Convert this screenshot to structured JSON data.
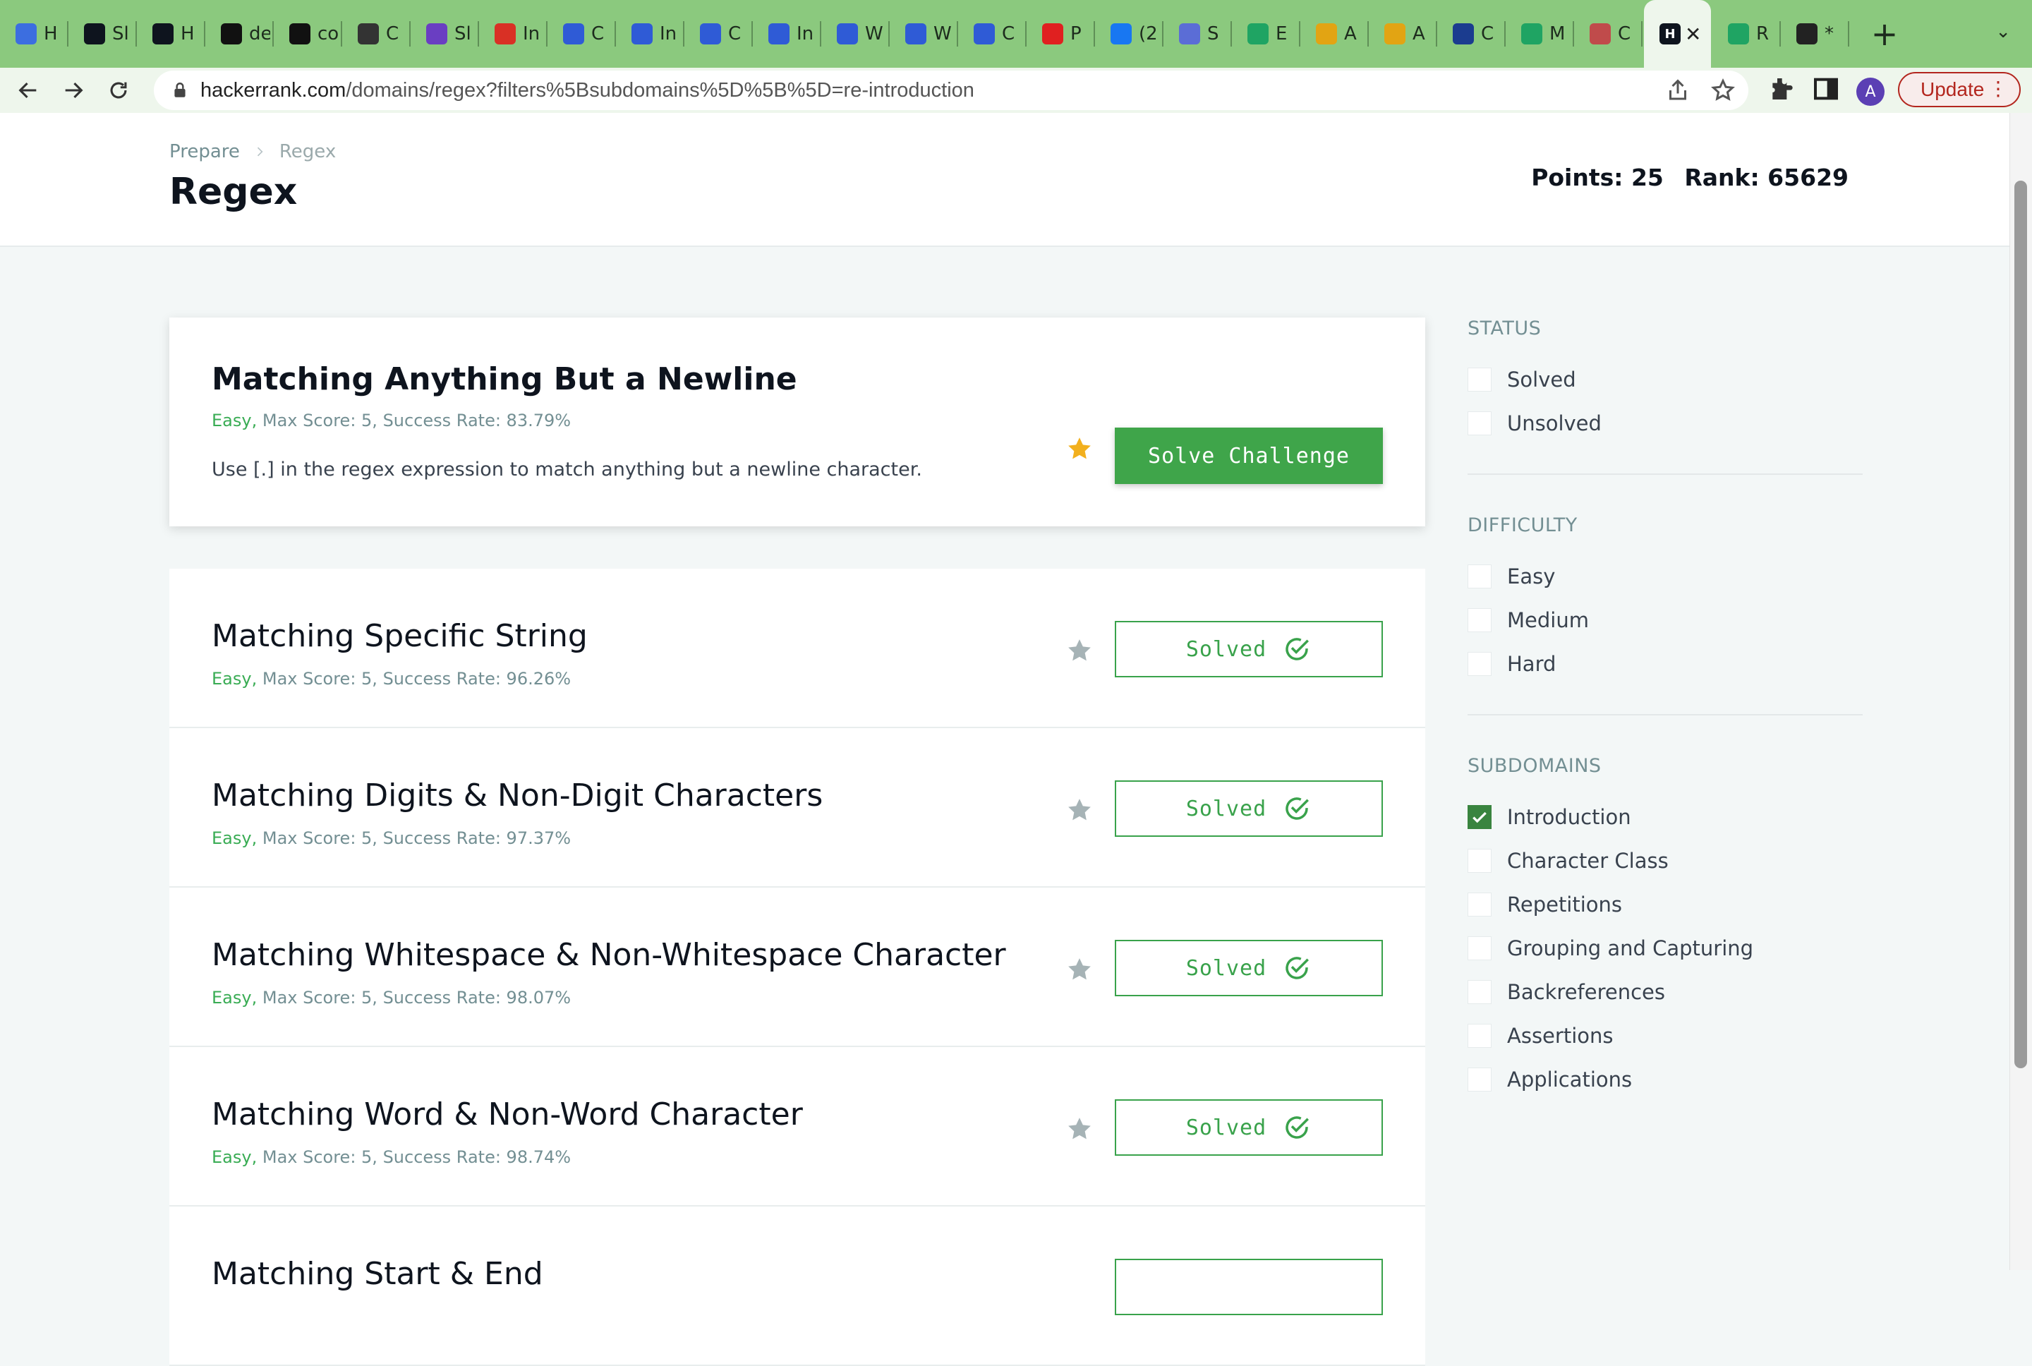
{
  "browser": {
    "tabs": [
      {
        "title": "H",
        "icon": "person-icon",
        "color": "#3c6ee0"
      },
      {
        "title": "Sl",
        "icon": "hackerrank-icon",
        "color": "#0e141e"
      },
      {
        "title": "H",
        "icon": "hackerrank-icon",
        "color": "#0e141e"
      },
      {
        "title": "de",
        "icon": "github-icon",
        "color": "#111111"
      },
      {
        "title": "co",
        "icon": "github-icon",
        "color": "#111111"
      },
      {
        "title": "C",
        "icon": "brain-icon",
        "color": "#333333"
      },
      {
        "title": "Sl",
        "icon": "list-icon",
        "color": "#6a3ec2"
      },
      {
        "title": "In",
        "icon": "gmail-icon",
        "color": "#d93025"
      },
      {
        "title": "C",
        "icon": "c-icon",
        "color": "#2f5bd6"
      },
      {
        "title": "In",
        "icon": "c-icon",
        "color": "#2f5bd6"
      },
      {
        "title": "C",
        "icon": "c-icon",
        "color": "#2f5bd6"
      },
      {
        "title": "In",
        "icon": "c-icon",
        "color": "#2f5bd6"
      },
      {
        "title": "W",
        "icon": "c-icon",
        "color": "#2f5bd6"
      },
      {
        "title": "W",
        "icon": "c-icon",
        "color": "#2f5bd6"
      },
      {
        "title": "C",
        "icon": "c-icon",
        "color": "#2f5bd6"
      },
      {
        "title": "P",
        "icon": "youtube-icon",
        "color": "#e02020"
      },
      {
        "title": "(2",
        "icon": "facebook-icon",
        "color": "#1877f2"
      },
      {
        "title": "S",
        "icon": "wave-icon",
        "color": "#5b6dd6"
      },
      {
        "title": "E",
        "icon": "drive-icon",
        "color": "#1fa463"
      },
      {
        "title": "A",
        "icon": "link-icon",
        "color": "#e2a413"
      },
      {
        "title": "A",
        "icon": "link-icon",
        "color": "#e2a413"
      },
      {
        "title": "C",
        "icon": "circle-icon",
        "color": "#1b3c8f"
      },
      {
        "title": "M",
        "icon": "drive-icon",
        "color": "#1fa463"
      },
      {
        "title": "C",
        "icon": "doc-icon",
        "color": "#c04b4b"
      }
    ],
    "active_tab": {
      "icon": "hackerrank-icon",
      "close": "✕"
    },
    "after_tabs": [
      {
        "title": "R",
        "icon": "drive-icon",
        "color": "#1fa463"
      },
      {
        "title": "*",
        "icon": "globe-icon",
        "color": "#222222"
      }
    ],
    "new_tab": "+",
    "tab_menu": "⌄",
    "url_host": "hackerrank.com",
    "url_path": "/domains/regex?filters%5Bsubdomains%5D%5B%5D=re-introduction",
    "profile_initial": "A",
    "update_label": "Update"
  },
  "header": {
    "breadcrumb": [
      "Prepare",
      "Regex"
    ],
    "title": "Regex",
    "points": "Points: 25",
    "rank": "Rank: 65629"
  },
  "challenges": [
    {
      "title": "Matching Anything But a Newline",
      "difficulty": "Easy,",
      "meta": "Max Score: 5, Success Rate: 83.79%",
      "description": "Use [.] in the regex expression to match anything but a newline character.",
      "action": "Solve Challenge",
      "featured": true,
      "star_color": "#f2b01e"
    },
    {
      "title": "Matching Specific String",
      "difficulty": "Easy,",
      "meta": "Max Score: 5, Success Rate: 96.26%",
      "action": "Solved",
      "star_color": "#a6b3b6"
    },
    {
      "title": "Matching Digits & Non-Digit Characters",
      "difficulty": "Easy,",
      "meta": "Max Score: 5, Success Rate: 97.37%",
      "action": "Solved",
      "star_color": "#a6b3b6"
    },
    {
      "title": "Matching Whitespace & Non-Whitespace Character",
      "difficulty": "Easy,",
      "meta": "Max Score: 5, Success Rate: 98.07%",
      "action": "Solved",
      "star_color": "#a6b3b6"
    },
    {
      "title": "Matching Word & Non-Word Character",
      "difficulty": "Easy,",
      "meta": "Max Score: 5, Success Rate: 98.74%",
      "action": "Solved",
      "star_color": "#a6b3b6"
    },
    {
      "title": "Matching Start & End",
      "difficulty": "",
      "meta": "",
      "action": "",
      "star_color": "#a6b3b6"
    }
  ],
  "filters": {
    "status": {
      "title": "STATUS",
      "options": [
        {
          "label": "Solved",
          "checked": false
        },
        {
          "label": "Unsolved",
          "checked": false
        }
      ]
    },
    "difficulty": {
      "title": "DIFFICULTY",
      "options": [
        {
          "label": "Easy",
          "checked": false
        },
        {
          "label": "Medium",
          "checked": false
        },
        {
          "label": "Hard",
          "checked": false
        }
      ]
    },
    "subdomains": {
      "title": "SUBDOMAINS",
      "options": [
        {
          "label": "Introduction",
          "checked": true
        },
        {
          "label": "Character Class",
          "checked": false
        },
        {
          "label": "Repetitions",
          "checked": false
        },
        {
          "label": "Grouping and Capturing",
          "checked": false
        },
        {
          "label": "Backreferences",
          "checked": false
        },
        {
          "label": "Assertions",
          "checked": false
        },
        {
          "label": "Applications",
          "checked": false
        }
      ]
    }
  }
}
